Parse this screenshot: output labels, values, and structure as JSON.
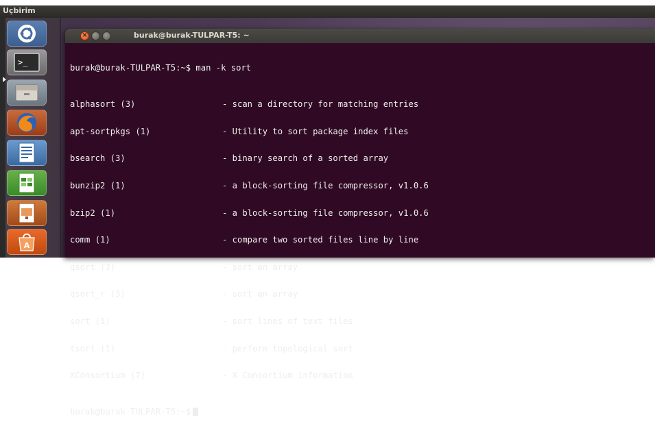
{
  "topbar": {
    "title": "Uçbirim"
  },
  "terminal": {
    "window_title": "burak@burak-TULPAR-T5: ~",
    "command_line": "burak@burak-TULPAR-T5:~$ man -k sort",
    "entries": [
      {
        "name": "alphasort (3)",
        "desc": "- scan a directory for matching entries"
      },
      {
        "name": "apt-sortpkgs (1)",
        "desc": "- Utility to sort package index files"
      },
      {
        "name": "bsearch (3)",
        "desc": "- binary search of a sorted array"
      },
      {
        "name": "bunzip2 (1)",
        "desc": "- a block-sorting file compressor, v1.0.6"
      },
      {
        "name": "bzip2 (1)",
        "desc": "- a block-sorting file compressor, v1.0.6"
      },
      {
        "name": "comm (1)",
        "desc": "- compare two sorted files line by line"
      },
      {
        "name": "qsort (3)",
        "desc": "- sort an array"
      },
      {
        "name": "qsort_r (3)",
        "desc": "- sort an array"
      },
      {
        "name": "sort (1)",
        "desc": "- sort lines of text files"
      },
      {
        "name": "tsort (1)",
        "desc": "- perform topological sort"
      },
      {
        "name": "XConsortium (7)",
        "desc": "- X Consortium information"
      }
    ],
    "prompt": "burak@burak-TULPAR-T5:~$"
  },
  "launcher": {
    "items": [
      {
        "icon": "ubuntu-dash-icon"
      },
      {
        "icon": "terminal-icon"
      },
      {
        "icon": "files-icon"
      },
      {
        "icon": "firefox-icon"
      },
      {
        "icon": "writer-icon"
      },
      {
        "icon": "calc-icon"
      },
      {
        "icon": "impress-icon"
      },
      {
        "icon": "software-center-icon"
      }
    ]
  },
  "colors": {
    "terminal_bg": "#300a24",
    "terminal_fg": "#eeeeec",
    "close_button": "#df4a16",
    "panel_bg": "#3c3b37"
  }
}
